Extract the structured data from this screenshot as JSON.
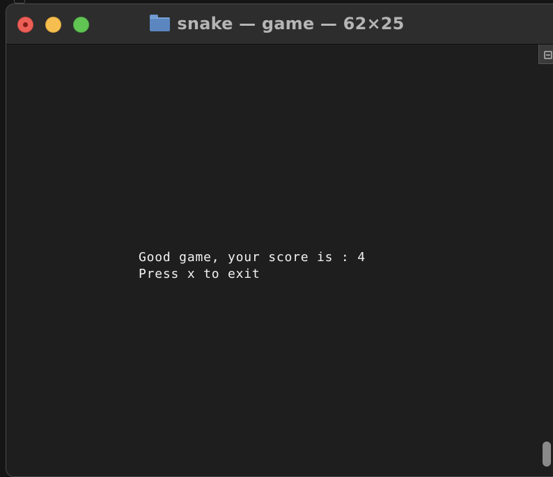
{
  "window": {
    "title": "snake — game — 62×25",
    "title_icon": "folder-icon"
  },
  "traffic_lights": {
    "close_color": "#ec5f57",
    "minimize_color": "#f5be4f",
    "zoom_color": "#61c554"
  },
  "terminal": {
    "background": "#1e1e1e",
    "text_color": "#f2f2f2",
    "lines": [
      "Good game, your score is : 4",
      "Press x to exit"
    ]
  },
  "scrollbar": {
    "icon": "split-pane-icon"
  }
}
